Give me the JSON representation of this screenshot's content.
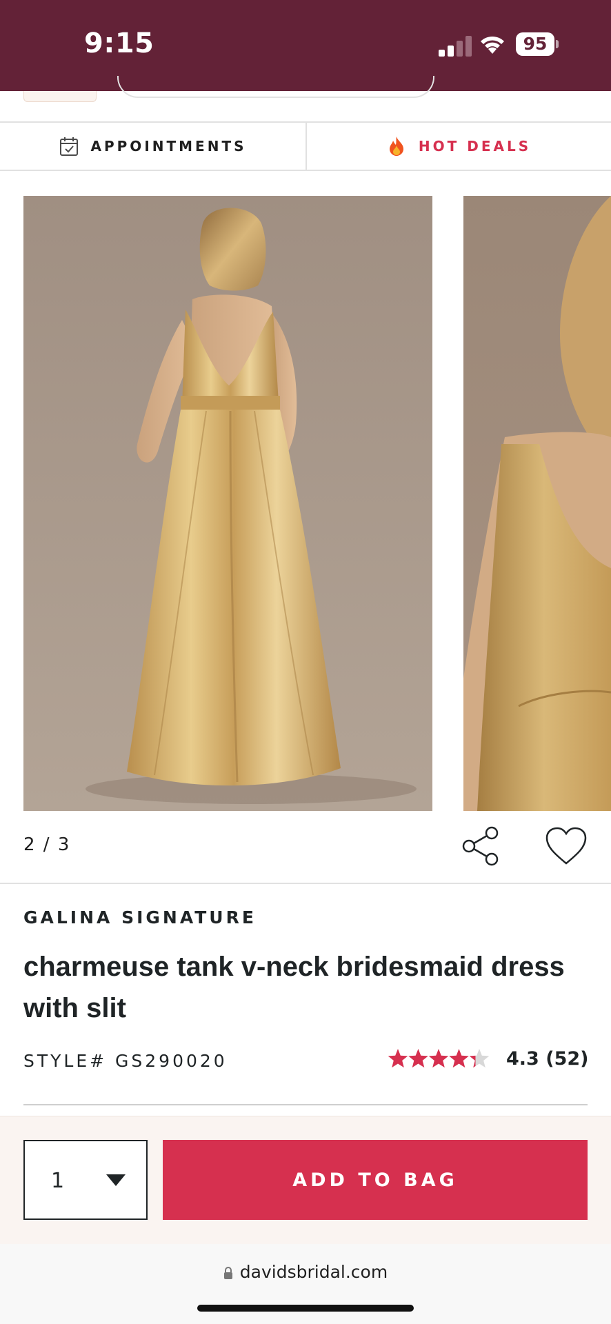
{
  "status_bar": {
    "time": "9:15",
    "battery": "95"
  },
  "nav": {
    "appointments_label": "APPOINTMENTS",
    "hot_deals_label": "HOT DEALS"
  },
  "gallery": {
    "counter": "2 / 3"
  },
  "product": {
    "brand": "GALINA SIGNATURE",
    "title": "charmeuse tank v-neck bridesmaid dress with slit",
    "style": "STYLE# GS290020",
    "rating_value": 4.3,
    "rating_text": "4.3 (52)"
  },
  "purchase": {
    "quantity": "1",
    "add_to_bag_label": "ADD TO BAG"
  },
  "browser": {
    "url": "davidsbridal.com"
  },
  "colors": {
    "header": "#632237",
    "accent": "#d6304f",
    "text": "#1f2426"
  },
  "icons": [
    "signal-icon",
    "wifi-icon",
    "calendar-icon",
    "flame-icon",
    "share-icon",
    "heart-icon",
    "star-icon",
    "lock-icon",
    "dropdown-caret-icon"
  ]
}
